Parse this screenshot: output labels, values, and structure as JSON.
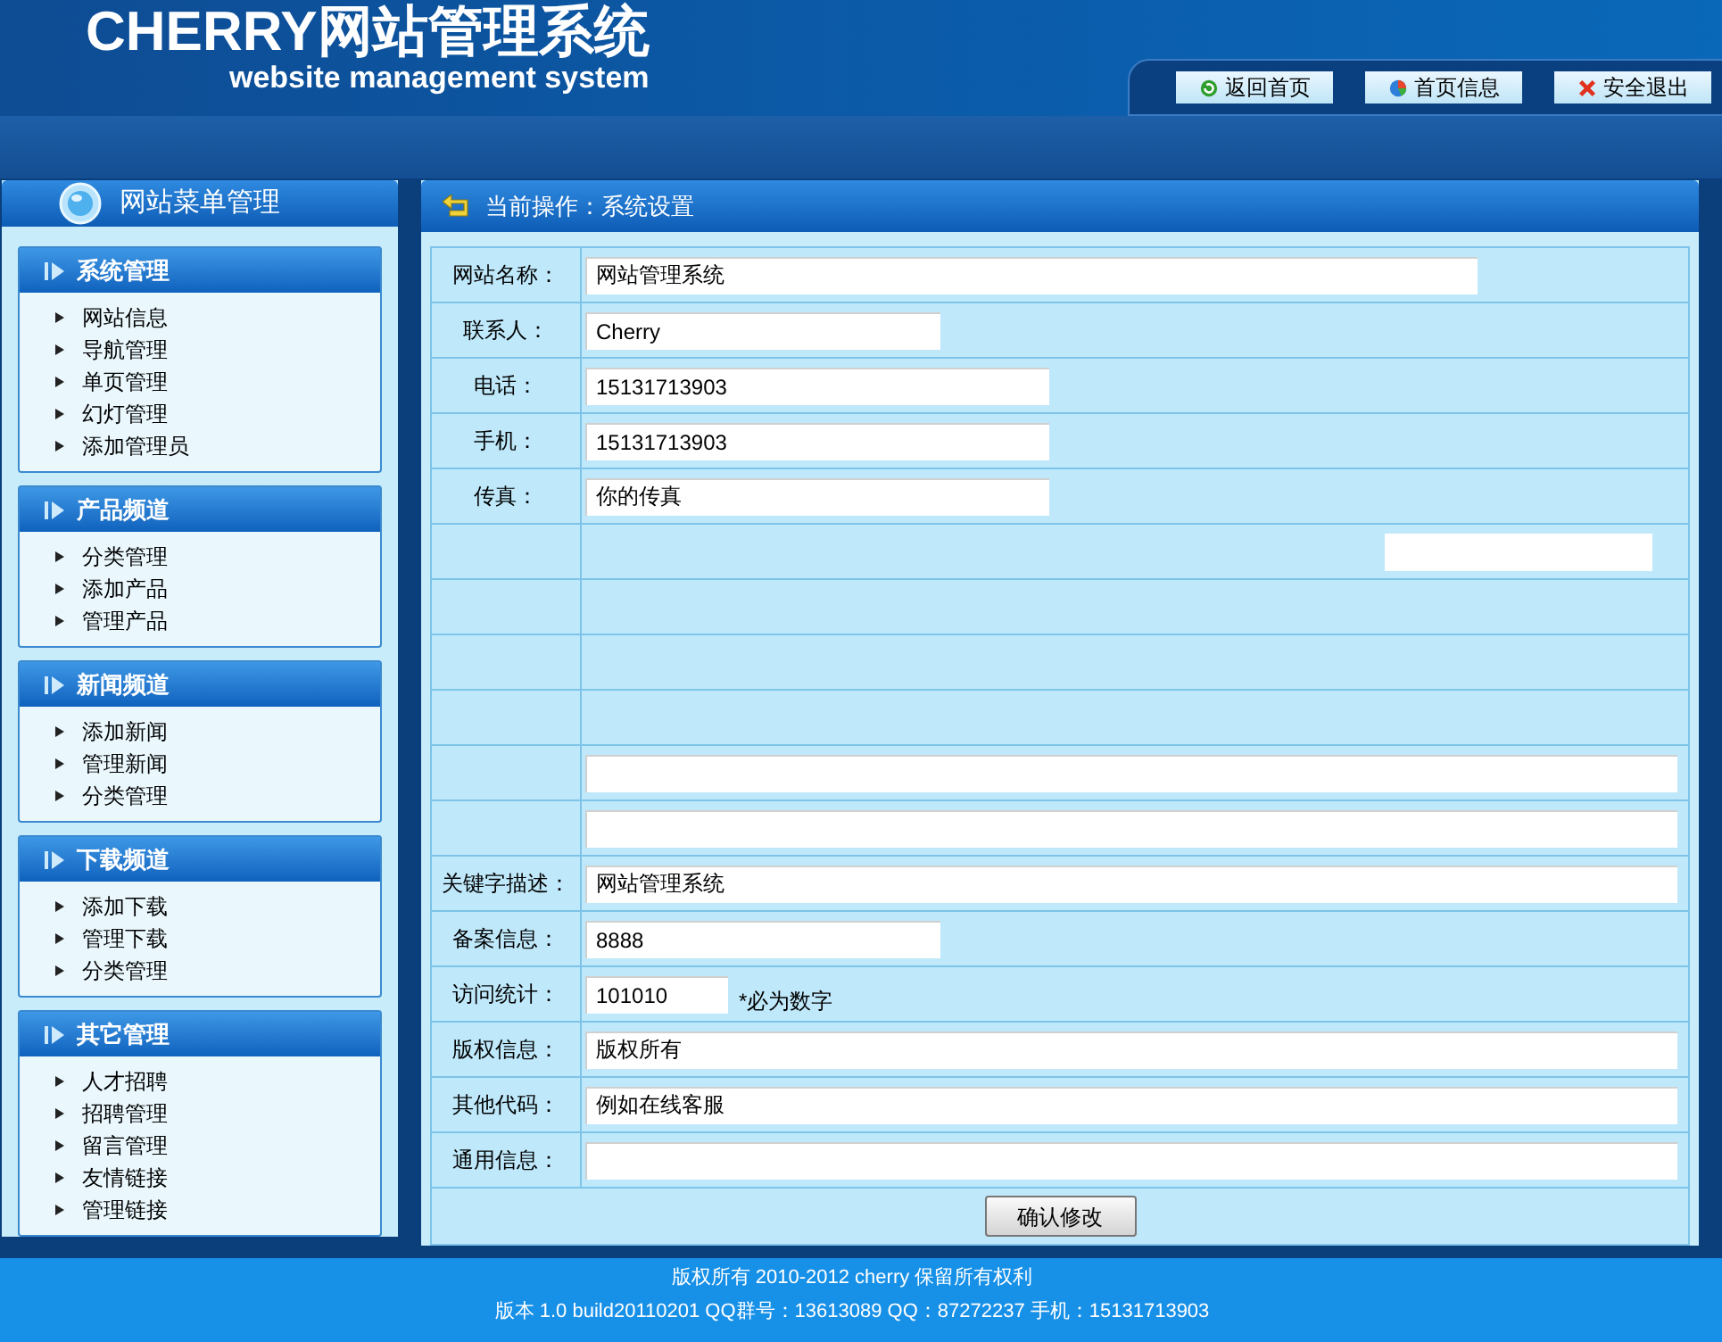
{
  "header": {
    "title": "CHERRY网站管理系统",
    "subtitle": "website management system",
    "links": [
      {
        "label": "返回首页",
        "kind": "refresh"
      },
      {
        "label": "首页信息",
        "kind": "pie"
      },
      {
        "label": "安全退出",
        "kind": "close"
      }
    ]
  },
  "sidebar": {
    "title": "网站菜单管理",
    "sections": [
      {
        "title": "系统管理",
        "items": [
          "网站信息",
          "导航管理",
          "单页管理",
          "幻灯管理",
          "添加管理员"
        ]
      },
      {
        "title": "产品频道",
        "items": [
          "分类管理",
          "添加产品",
          "管理产品"
        ]
      },
      {
        "title": "新闻频道",
        "items": [
          "添加新闻",
          "管理新闻",
          "分类管理"
        ]
      },
      {
        "title": "下载频道",
        "items": [
          "添加下载",
          "管理下载",
          "分类管理"
        ]
      },
      {
        "title": "其它管理",
        "items": [
          "人才招聘",
          "招聘管理",
          "留言管理",
          "友情链接",
          "管理链接"
        ]
      }
    ]
  },
  "main": {
    "breadcrumb": "当前操作：系统设置",
    "rows": [
      {
        "label": "网站名称：",
        "value": "网站管理系统",
        "kind": "long"
      },
      {
        "label": "联系人：",
        "value": "Cherry",
        "kind": "short"
      },
      {
        "label": "电话：",
        "value": "15131713903",
        "kind": "medium"
      },
      {
        "label": "手机：",
        "value": "15131713903",
        "kind": "medium"
      },
      {
        "label": "传真：",
        "value": "你的传真",
        "kind": "medium"
      },
      {
        "kind": "right"
      },
      {
        "kind": "blank"
      },
      {
        "kind": "blank"
      },
      {
        "kind": "blank"
      },
      {
        "kind": "full"
      },
      {
        "kind": "full"
      },
      {
        "label": "关键字描述：",
        "value": "网站管理系统",
        "kind": "full"
      },
      {
        "label": "备案信息：",
        "value": "8888",
        "kind": "short"
      },
      {
        "label": "访问统计：",
        "value": "101010",
        "kind": "tiny",
        "note": "*必为数字"
      },
      {
        "label": "版权信息：",
        "value": "版权所有",
        "kind": "full"
      },
      {
        "label": "其他代码：",
        "value": "例如在线客服",
        "kind": "full"
      },
      {
        "label": "通用信息：",
        "kind": "full"
      }
    ],
    "submit": "确认修改"
  },
  "footer": {
    "lines": [
      "版权所有 2010-2012 cherry 保留所有权利",
      "版本 1.0 build20110201 QQ群号：13613089 QQ：87272237 手机：15131713903"
    ]
  }
}
